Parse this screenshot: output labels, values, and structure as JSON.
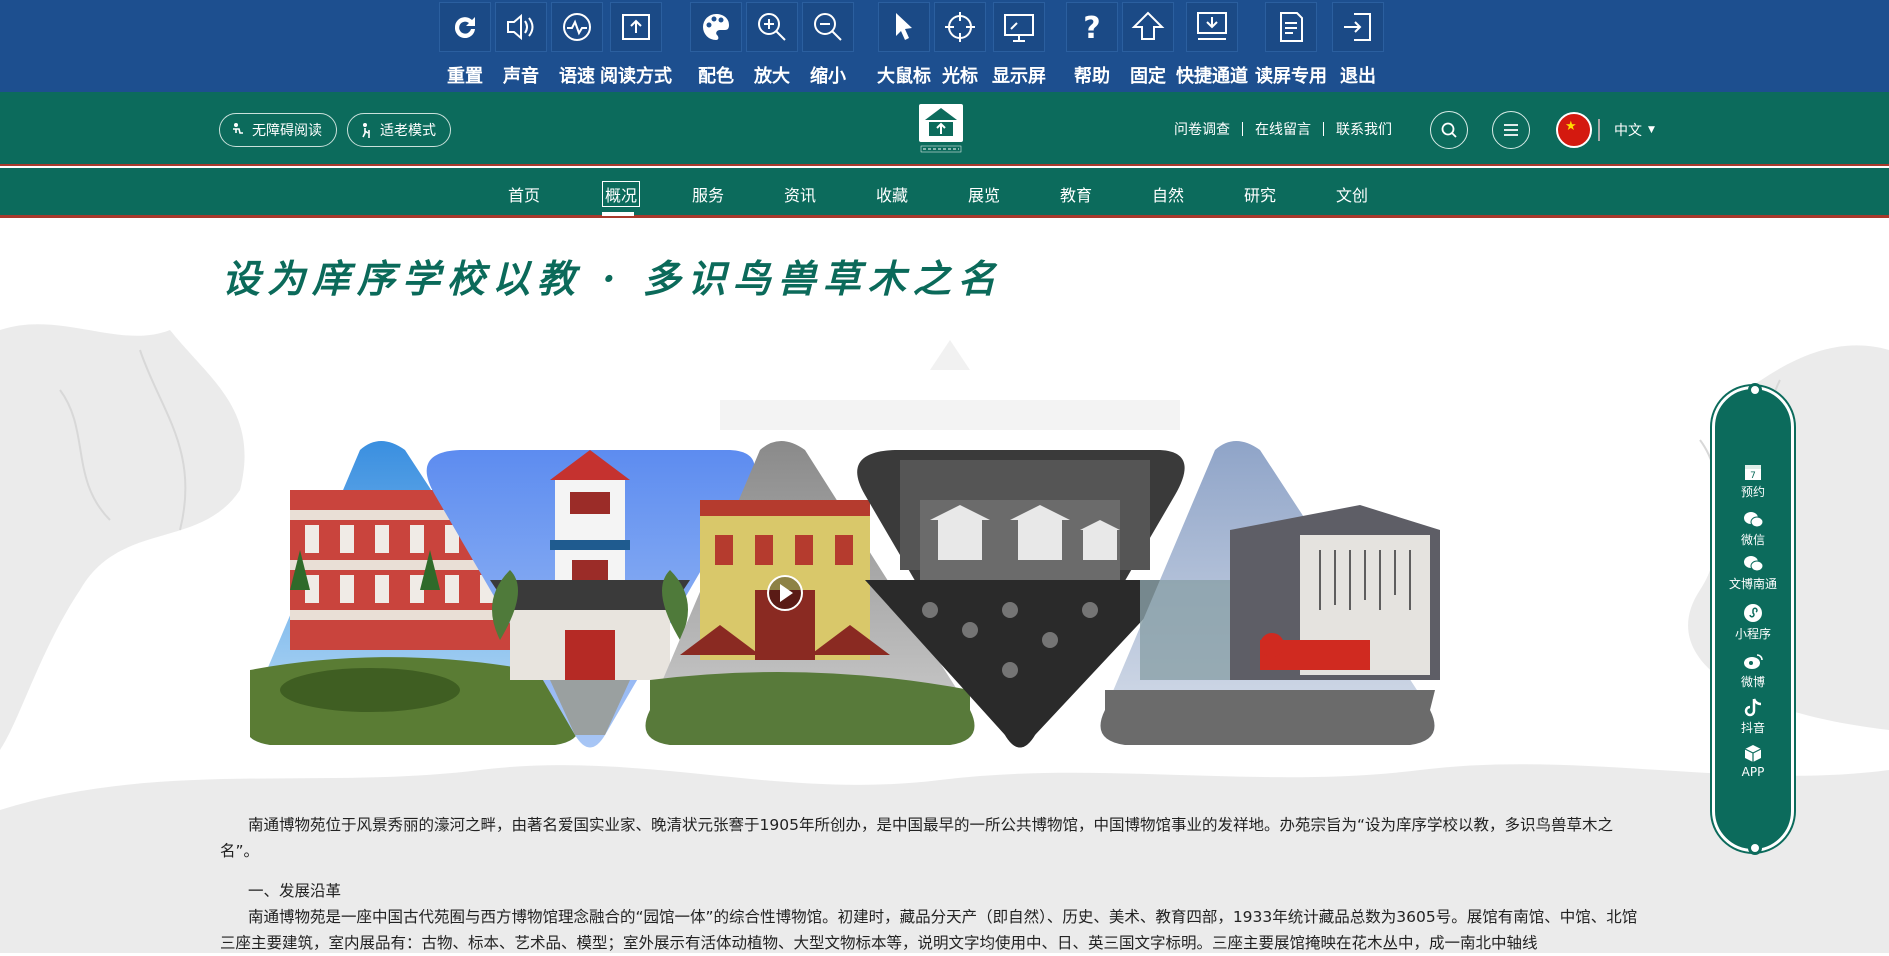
{
  "toolbar": {
    "items": [
      {
        "label": "重置",
        "icon": "reset-icon"
      },
      {
        "label": "声音",
        "icon": "speaker-icon"
      },
      {
        "label": "语速",
        "icon": "speed-icon"
      },
      {
        "label": "阅读方式",
        "icon": "reading-mode-icon"
      },
      {
        "label": "配色",
        "icon": "palette-icon"
      },
      {
        "label": "放大",
        "icon": "zoom-in-icon"
      },
      {
        "label": "缩小",
        "icon": "zoom-out-icon"
      },
      {
        "label": "大鼠标",
        "icon": "cursor-icon"
      },
      {
        "label": "光标",
        "icon": "crosshair-icon"
      },
      {
        "label": "显示屏",
        "icon": "display-icon"
      },
      {
        "label": "帮助",
        "icon": "help-icon"
      },
      {
        "label": "固定",
        "icon": "pin-up-icon"
      },
      {
        "label": "快捷通道",
        "icon": "shortcut-icon"
      },
      {
        "label": "读屏专用",
        "icon": "screen-reader-icon"
      },
      {
        "label": "退出",
        "icon": "exit-icon"
      }
    ]
  },
  "header": {
    "accessible_reading": "无障碍阅读",
    "elderly_mode": "适老模式",
    "links": [
      "问卷调查",
      "在线留言",
      "联系我们"
    ],
    "language": "中文",
    "logo_icon": "museum-logo-icon"
  },
  "nav": {
    "items": [
      "首页",
      "概况",
      "服务",
      "资讯",
      "收藏",
      "展览",
      "教育",
      "自然",
      "研究",
      "文创"
    ],
    "active_index": 1
  },
  "page": {
    "slogan": "设为庠序学校以教 · 多识鸟兽草木之名"
  },
  "sidebar": {
    "items": [
      {
        "label": "预约",
        "icon": "calendar-icon"
      },
      {
        "label": "微信",
        "icon": "wechat-icon"
      },
      {
        "label": "文博南通",
        "icon": "wechat-icon"
      },
      {
        "label": "小程序",
        "icon": "mini-program-icon"
      },
      {
        "label": "微博",
        "icon": "weibo-icon"
      },
      {
        "label": "抖音",
        "icon": "douyin-icon"
      },
      {
        "label": "APP",
        "icon": "app-cube-icon"
      }
    ]
  },
  "content": {
    "intro": "南通博物苑位于风景秀丽的濠河之畔，由著名爱国实业家、晚清状元张謇于1905年所创办，是中国最早的一所公共博物馆，中国博物馆事业的发祥地。办苑宗旨为“设为庠序学校以教，多识鸟兽草木之名”。",
    "section1_title": "一、发展沿革",
    "section1_text": "南通博物苑是一座中国古代苑囿与西方博物馆理念融合的“园馆一体”的综合性博物馆。初建时，藏品分天产（即自然）、历史、美术、教育四部，1933年统计藏品总数为3605号。展馆有南馆、中馆、北馆三座主要建筑，室内展品有：古物、标本、艺术品、模型；室外展示有活体动植物、大型文物标本等，说明文字均使用中、日、英三国文字标明。三座主要展馆掩映在花木丛中，成一南北中轴线"
  },
  "colors": {
    "toolbar_bg": "#1d4f8f",
    "header_bg": "#0c6b5c",
    "accent_red": "#a8392c",
    "title_green": "#0b6a5a"
  }
}
